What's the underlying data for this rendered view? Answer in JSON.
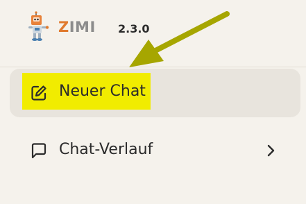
{
  "header": {
    "brand_name": "ZIMI",
    "version": "2.3.0",
    "logo_icon": "robot-mascot-icon"
  },
  "nav": {
    "items": [
      {
        "label": "Neuer Chat",
        "icon": "edit-pencil-icon",
        "active": true
      },
      {
        "label": "Chat-Verlauf",
        "icon": "chat-bubble-icon",
        "has_submenu": true,
        "submenu_icon": "chevron-right-icon"
      }
    ]
  },
  "annotation": {
    "highlight_color": "#f1ec00",
    "arrow_color": "#a6a600",
    "arrow_icon": "annotation-arrow-icon"
  },
  "colors": {
    "background": "#f5f2ec",
    "active_item_bg": "#e8e4dd",
    "brand_orange": "#e07a2e"
  }
}
